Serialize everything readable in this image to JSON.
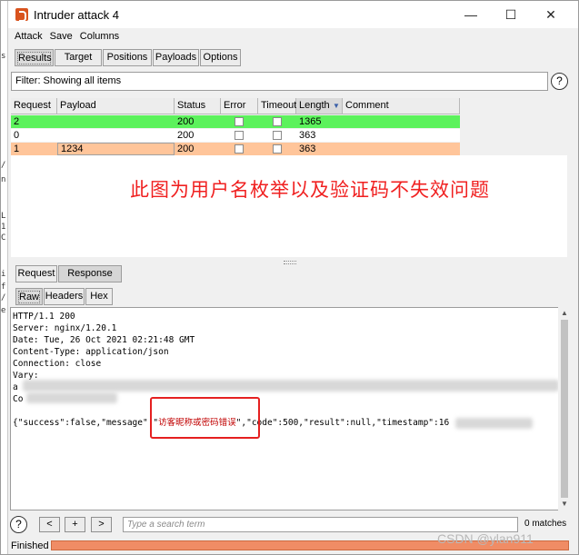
{
  "window": {
    "title": "Intruder attack 4",
    "controls": {
      "minimize": "—",
      "maximize": "☐",
      "close": "✕"
    }
  },
  "menu": [
    "Attack",
    "Save",
    "Columns"
  ],
  "main_tabs": [
    "Results",
    "Target",
    "Positions",
    "Payloads",
    "Options"
  ],
  "filter": {
    "text": "Filter: Showing all items",
    "help": "?"
  },
  "table": {
    "columns": [
      "Request",
      "Payload",
      "Status",
      "Error",
      "Timeout",
      "Length",
      "Comment"
    ],
    "sort_indicator": "▼",
    "rows": [
      {
        "request": "2",
        "payload": "",
        "status": "200",
        "error": false,
        "timeout": false,
        "length": "1365",
        "comment": "",
        "color": "#5cf25c"
      },
      {
        "request": "0",
        "payload": "",
        "status": "200",
        "error": false,
        "timeout": false,
        "length": "363",
        "comment": "",
        "color": "#ffffff"
      },
      {
        "request": "1",
        "payload": "1234",
        "status": "200",
        "error": false,
        "timeout": false,
        "length": "363",
        "comment": "",
        "color": "#ffc59a"
      }
    ]
  },
  "annotation": "此图为用户名枚举以及验证码不失效问题",
  "detail_tabs": [
    "Request",
    "Response"
  ],
  "view_tabs": [
    "Raw",
    "Headers",
    "Hex"
  ],
  "response": {
    "lines": [
      "HTTP/1.1 200",
      "Server: nginx/1.20.1",
      "Date: Tue, 26 Oct 2021 02:21:48 GMT",
      "Content-Type: application/json",
      "Connection: close",
      "Vary:",
      "a",
      "Co",
      "",
      "{\"success\":false,\"message\":\"访客昵称或密码错误\",\"code\":500,\"result\":null,\"timestamp\":16"
    ],
    "highlight_text": "访客昵称或密码错误"
  },
  "search": {
    "help": "?",
    "prev": "<",
    "add": "+",
    "next": ">",
    "placeholder": "Type a search term",
    "matches": "0 matches"
  },
  "status": {
    "text": "Finished",
    "progress": 1.0
  },
  "watermark": "CSDN @ylan911",
  "colors": {
    "green_row": "#5cf25c",
    "orange_row": "#ffc59a",
    "annotation": "#f02020",
    "progress": "#f08c65"
  }
}
